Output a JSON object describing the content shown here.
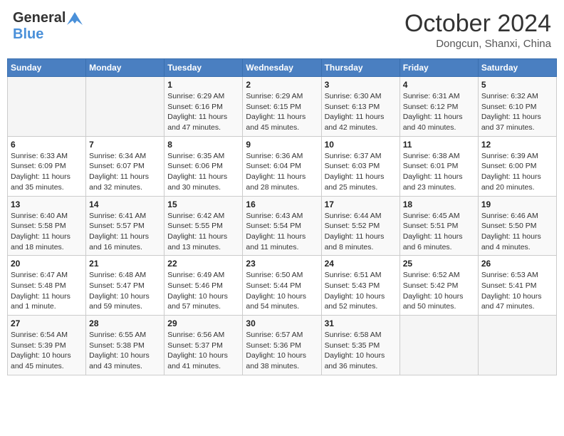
{
  "header": {
    "logo_general": "General",
    "logo_blue": "Blue",
    "month": "October 2024",
    "location": "Dongcun, Shanxi, China"
  },
  "calendar": {
    "days_of_week": [
      "Sunday",
      "Monday",
      "Tuesday",
      "Wednesday",
      "Thursday",
      "Friday",
      "Saturday"
    ],
    "weeks": [
      [
        {
          "day": "",
          "info": ""
        },
        {
          "day": "",
          "info": ""
        },
        {
          "day": "1",
          "info": "Sunrise: 6:29 AM\nSunset: 6:16 PM\nDaylight: 11 hours and 47 minutes."
        },
        {
          "day": "2",
          "info": "Sunrise: 6:29 AM\nSunset: 6:15 PM\nDaylight: 11 hours and 45 minutes."
        },
        {
          "day": "3",
          "info": "Sunrise: 6:30 AM\nSunset: 6:13 PM\nDaylight: 11 hours and 42 minutes."
        },
        {
          "day": "4",
          "info": "Sunrise: 6:31 AM\nSunset: 6:12 PM\nDaylight: 11 hours and 40 minutes."
        },
        {
          "day": "5",
          "info": "Sunrise: 6:32 AM\nSunset: 6:10 PM\nDaylight: 11 hours and 37 minutes."
        }
      ],
      [
        {
          "day": "6",
          "info": "Sunrise: 6:33 AM\nSunset: 6:09 PM\nDaylight: 11 hours and 35 minutes."
        },
        {
          "day": "7",
          "info": "Sunrise: 6:34 AM\nSunset: 6:07 PM\nDaylight: 11 hours and 32 minutes."
        },
        {
          "day": "8",
          "info": "Sunrise: 6:35 AM\nSunset: 6:06 PM\nDaylight: 11 hours and 30 minutes."
        },
        {
          "day": "9",
          "info": "Sunrise: 6:36 AM\nSunset: 6:04 PM\nDaylight: 11 hours and 28 minutes."
        },
        {
          "day": "10",
          "info": "Sunrise: 6:37 AM\nSunset: 6:03 PM\nDaylight: 11 hours and 25 minutes."
        },
        {
          "day": "11",
          "info": "Sunrise: 6:38 AM\nSunset: 6:01 PM\nDaylight: 11 hours and 23 minutes."
        },
        {
          "day": "12",
          "info": "Sunrise: 6:39 AM\nSunset: 6:00 PM\nDaylight: 11 hours and 20 minutes."
        }
      ],
      [
        {
          "day": "13",
          "info": "Sunrise: 6:40 AM\nSunset: 5:58 PM\nDaylight: 11 hours and 18 minutes."
        },
        {
          "day": "14",
          "info": "Sunrise: 6:41 AM\nSunset: 5:57 PM\nDaylight: 11 hours and 16 minutes."
        },
        {
          "day": "15",
          "info": "Sunrise: 6:42 AM\nSunset: 5:55 PM\nDaylight: 11 hours and 13 minutes."
        },
        {
          "day": "16",
          "info": "Sunrise: 6:43 AM\nSunset: 5:54 PM\nDaylight: 11 hours and 11 minutes."
        },
        {
          "day": "17",
          "info": "Sunrise: 6:44 AM\nSunset: 5:52 PM\nDaylight: 11 hours and 8 minutes."
        },
        {
          "day": "18",
          "info": "Sunrise: 6:45 AM\nSunset: 5:51 PM\nDaylight: 11 hours and 6 minutes."
        },
        {
          "day": "19",
          "info": "Sunrise: 6:46 AM\nSunset: 5:50 PM\nDaylight: 11 hours and 4 minutes."
        }
      ],
      [
        {
          "day": "20",
          "info": "Sunrise: 6:47 AM\nSunset: 5:48 PM\nDaylight: 11 hours and 1 minute."
        },
        {
          "day": "21",
          "info": "Sunrise: 6:48 AM\nSunset: 5:47 PM\nDaylight: 10 hours and 59 minutes."
        },
        {
          "day": "22",
          "info": "Sunrise: 6:49 AM\nSunset: 5:46 PM\nDaylight: 10 hours and 57 minutes."
        },
        {
          "day": "23",
          "info": "Sunrise: 6:50 AM\nSunset: 5:44 PM\nDaylight: 10 hours and 54 minutes."
        },
        {
          "day": "24",
          "info": "Sunrise: 6:51 AM\nSunset: 5:43 PM\nDaylight: 10 hours and 52 minutes."
        },
        {
          "day": "25",
          "info": "Sunrise: 6:52 AM\nSunset: 5:42 PM\nDaylight: 10 hours and 50 minutes."
        },
        {
          "day": "26",
          "info": "Sunrise: 6:53 AM\nSunset: 5:41 PM\nDaylight: 10 hours and 47 minutes."
        }
      ],
      [
        {
          "day": "27",
          "info": "Sunrise: 6:54 AM\nSunset: 5:39 PM\nDaylight: 10 hours and 45 minutes."
        },
        {
          "day": "28",
          "info": "Sunrise: 6:55 AM\nSunset: 5:38 PM\nDaylight: 10 hours and 43 minutes."
        },
        {
          "day": "29",
          "info": "Sunrise: 6:56 AM\nSunset: 5:37 PM\nDaylight: 10 hours and 41 minutes."
        },
        {
          "day": "30",
          "info": "Sunrise: 6:57 AM\nSunset: 5:36 PM\nDaylight: 10 hours and 38 minutes."
        },
        {
          "day": "31",
          "info": "Sunrise: 6:58 AM\nSunset: 5:35 PM\nDaylight: 10 hours and 36 minutes."
        },
        {
          "day": "",
          "info": ""
        },
        {
          "day": "",
          "info": ""
        }
      ]
    ]
  }
}
